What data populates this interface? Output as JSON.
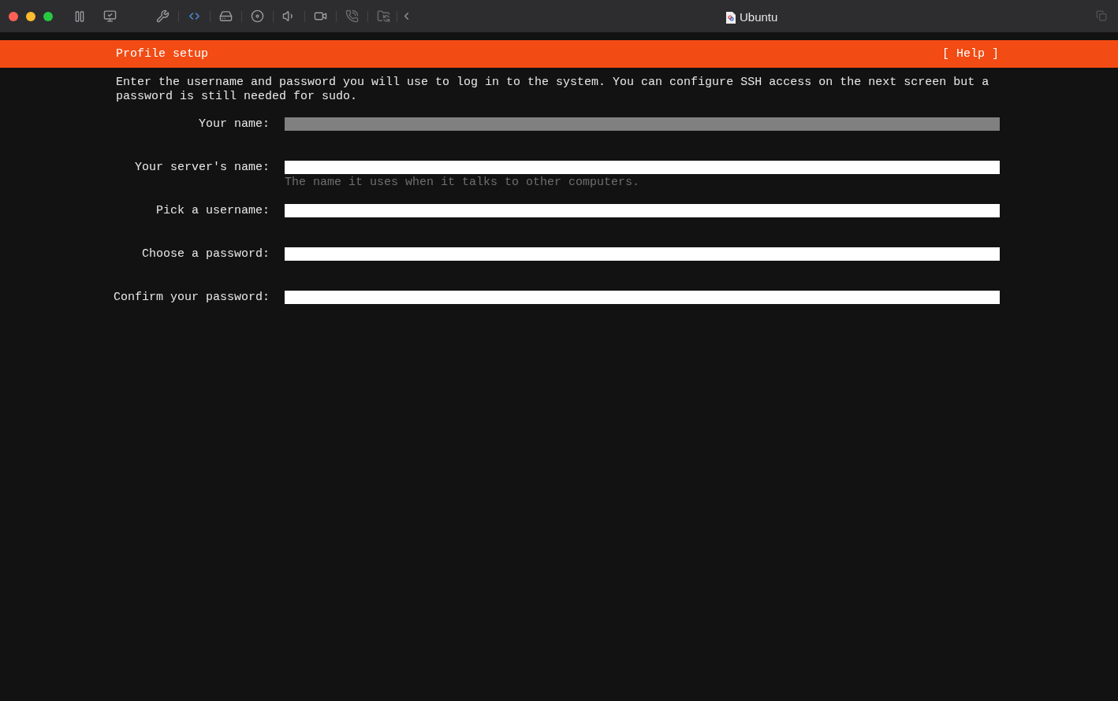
{
  "window": {
    "title": "Ubuntu"
  },
  "header": {
    "title": "Profile setup",
    "help": "[ Help ]"
  },
  "description": "Enter the username and password you will use to log in to the system. You can configure SSH access on the next screen but a password is still needed for sudo.",
  "fields": [
    {
      "label": "Your name:",
      "focused": true
    },
    {
      "label": "Your server's name:",
      "focused": false,
      "hint": "The name it uses when it talks to other computers."
    },
    {
      "label": "Pick a username:",
      "focused": false
    },
    {
      "label": "Choose a password:",
      "focused": false
    },
    {
      "label": "Confirm your password:",
      "focused": false
    }
  ]
}
